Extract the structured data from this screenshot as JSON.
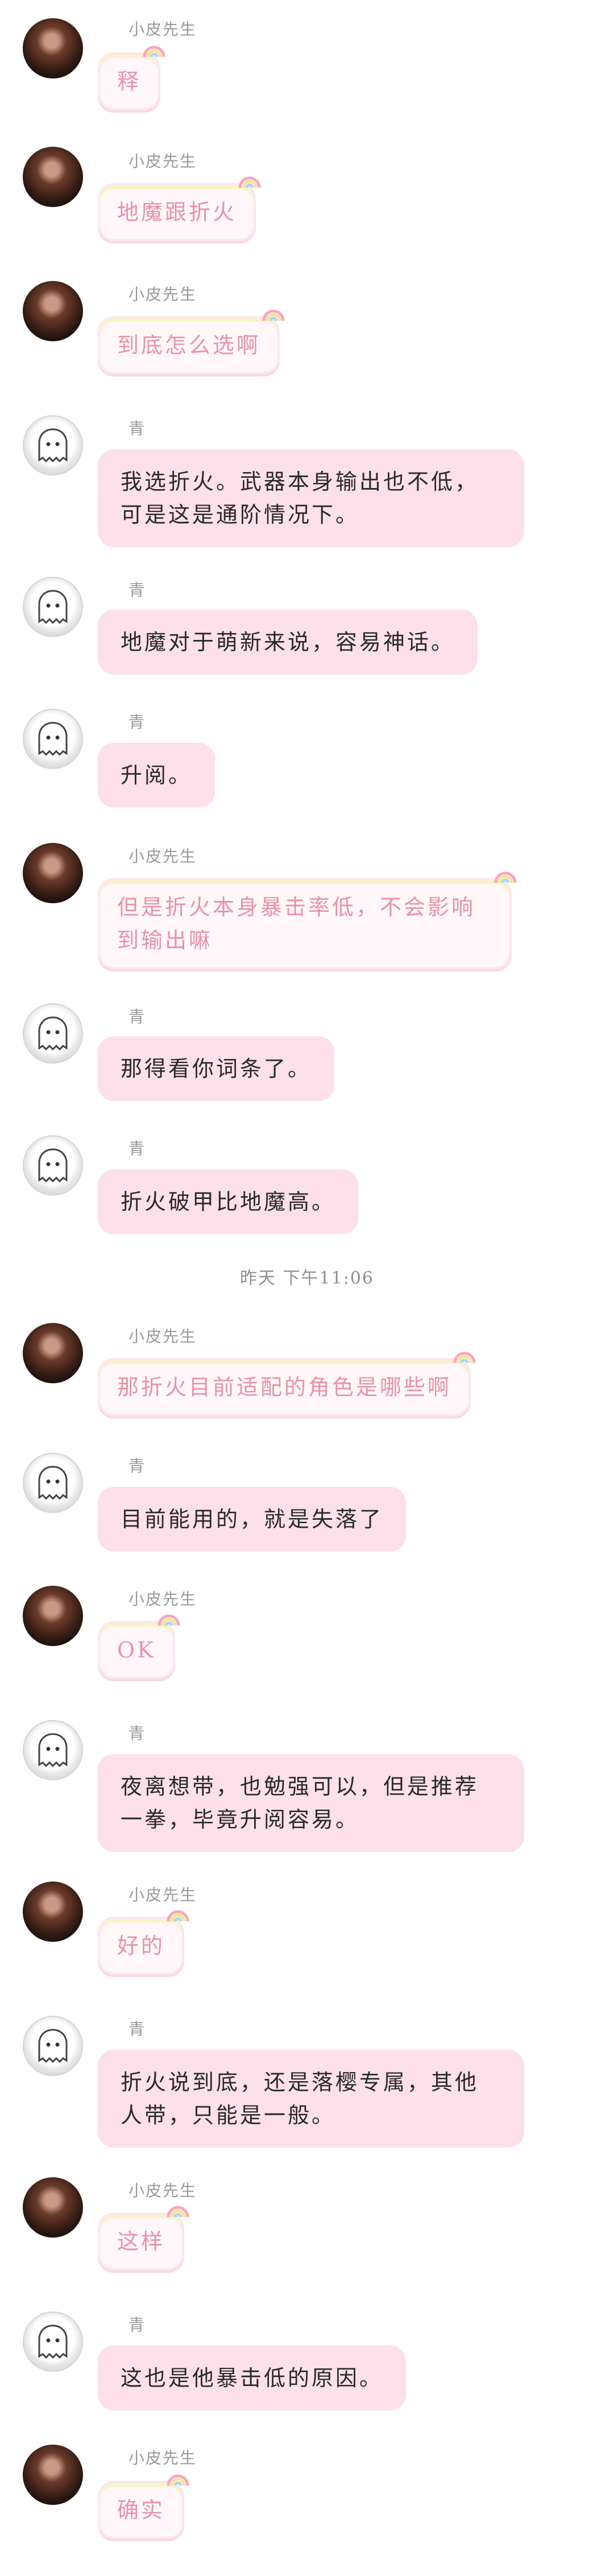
{
  "names": {
    "a": "小皮先生",
    "b": "青"
  },
  "timestamp": "昨天 下午11:06",
  "messages": [
    {
      "sender": "a",
      "text": "释"
    },
    {
      "sender": "a",
      "text": "地魔跟折火"
    },
    {
      "sender": "a",
      "text": "到底怎么选啊"
    },
    {
      "sender": "b",
      "text": "我选折火。武器本身输出也不低，可是这是通阶情况下。"
    },
    {
      "sender": "b",
      "text": "地魔对于萌新来说，容易神话。"
    },
    {
      "sender": "b",
      "text": "升阅。"
    },
    {
      "sender": "a",
      "text": "但是折火本身暴击率低，不会影响到输出嘛"
    },
    {
      "sender": "b",
      "text": "那得看你词条了。"
    },
    {
      "sender": "b",
      "text": "折火破甲比地魔高。"
    },
    {
      "sender": "a",
      "text": "那折火目前适配的角色是哪些啊"
    },
    {
      "sender": "b",
      "text": "目前能用的，就是失落了"
    },
    {
      "sender": "a",
      "text": "OK"
    },
    {
      "sender": "b",
      "text": "夜离想带，也勉强可以，但是推荐一拳，毕竟升阅容易。"
    },
    {
      "sender": "a",
      "text": "好的"
    },
    {
      "sender": "b",
      "text": "折火说到底，还是落樱专属，其他人带，只能是一般。"
    },
    {
      "sender": "a",
      "text": "这样"
    },
    {
      "sender": "b",
      "text": "这也是他暴击低的原因。"
    },
    {
      "sender": "a",
      "text": "确实"
    }
  ]
}
